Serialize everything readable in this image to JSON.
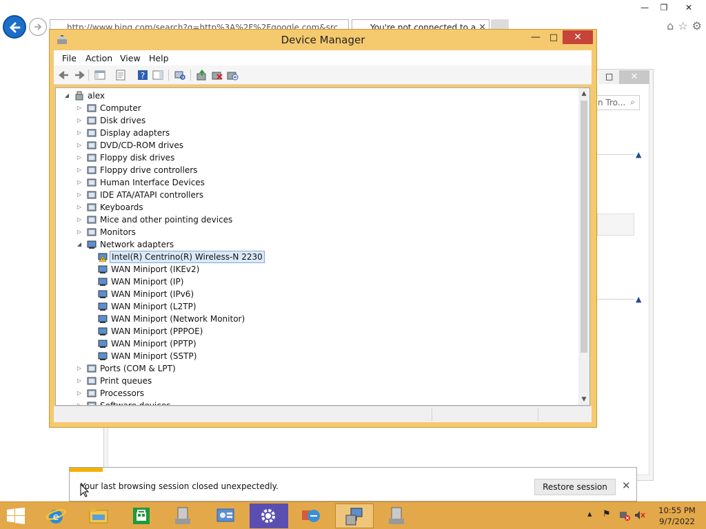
{
  "browser": {
    "address": "http://www.bing.com/search?q=http%3A%2F%2Fgoogle.com&src",
    "tab_title": "You're not connected to a",
    "tab_close": "×",
    "caption_min": "—",
    "caption_max": "❐",
    "caption_close": "✕",
    "page_search_placeholder": "n Tro...",
    "page_caption_max": "□",
    "page_caption_close": "✕"
  },
  "notification": {
    "message": "Your last browsing session closed unexpectedly.",
    "restore_label": "Restore session",
    "close_label": "✕"
  },
  "device_manager": {
    "title": "Device Manager",
    "menu": [
      "File",
      "Action",
      "View",
      "Help"
    ],
    "root": "alex",
    "categories": [
      {
        "label": "Computer",
        "icon": "computer-icon",
        "expanded": false
      },
      {
        "label": "Disk drives",
        "icon": "disk-drive-icon",
        "expanded": false
      },
      {
        "label": "Display adapters",
        "icon": "display-adapter-icon",
        "expanded": false
      },
      {
        "label": "DVD/CD-ROM drives",
        "icon": "dvd-drive-icon",
        "expanded": false
      },
      {
        "label": "Floppy disk drives",
        "icon": "floppy-disk-icon",
        "expanded": false
      },
      {
        "label": "Floppy drive controllers",
        "icon": "floppy-controller-icon",
        "expanded": false
      },
      {
        "label": "Human Interface Devices",
        "icon": "hid-icon",
        "expanded": false
      },
      {
        "label": "IDE ATA/ATAPI controllers",
        "icon": "ide-controller-icon",
        "expanded": false
      },
      {
        "label": "Keyboards",
        "icon": "keyboard-icon",
        "expanded": false
      },
      {
        "label": "Mice and other pointing devices",
        "icon": "mouse-icon",
        "expanded": false
      },
      {
        "label": "Monitors",
        "icon": "monitor-icon",
        "expanded": false
      },
      {
        "label": "Network adapters",
        "icon": "network-adapter-icon",
        "expanded": true,
        "children": [
          {
            "label": "Intel(R) Centrino(R) Wireless-N 2230",
            "warning": true,
            "selected": true
          },
          {
            "label": "WAN Miniport (IKEv2)"
          },
          {
            "label": "WAN Miniport (IP)"
          },
          {
            "label": "WAN Miniport (IPv6)"
          },
          {
            "label": "WAN Miniport (L2TP)"
          },
          {
            "label": "WAN Miniport (Network Monitor)"
          },
          {
            "label": "WAN Miniport (PPPOE)"
          },
          {
            "label": "WAN Miniport (PPTP)"
          },
          {
            "label": "WAN Miniport (SSTP)"
          }
        ]
      },
      {
        "label": "Ports (COM & LPT)",
        "icon": "port-icon",
        "expanded": false
      },
      {
        "label": "Print queues",
        "icon": "printer-icon",
        "expanded": false
      },
      {
        "label": "Processors",
        "icon": "processor-icon",
        "expanded": false
      },
      {
        "label": "Software devices",
        "icon": "software-device-icon",
        "expanded": false
      }
    ],
    "caption_min": "—",
    "caption_max": "□",
    "caption_close": "✕"
  },
  "taskbar": {
    "time": "10:55 PM",
    "date": "9/7/2022",
    "apps": [
      "internet-explorer",
      "file-explorer",
      "store",
      "device-manager-a",
      "control-panel",
      "settings",
      "remote-desktop",
      "device-manager-active",
      "device-manager-b"
    ]
  },
  "colors": {
    "titlebar": "#f5c96e",
    "taskbar": "#e3a84a",
    "close_red": "#c7443a",
    "selection": "#dbe9f7"
  }
}
